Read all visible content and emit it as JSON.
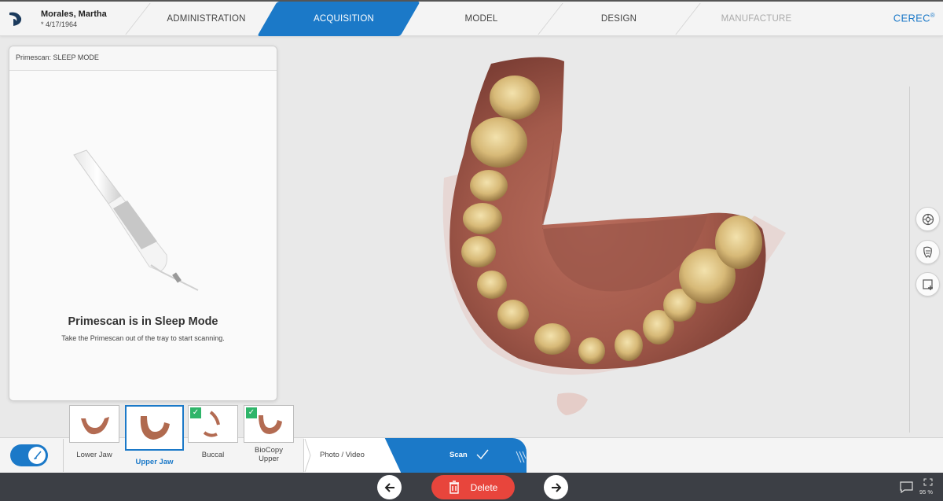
{
  "patient": {
    "name": "Morales, Martha",
    "dob": "* 4/17/1964"
  },
  "tabs": [
    {
      "label": "ADMINISTRATION",
      "state": "normal"
    },
    {
      "label": "ACQUISITION",
      "state": "active"
    },
    {
      "label": "MODEL",
      "state": "normal"
    },
    {
      "label": "DESIGN",
      "state": "normal"
    },
    {
      "label": "MANUFACTURE",
      "state": "disabled"
    }
  ],
  "brand": {
    "name": "CEREC",
    "mark": "®"
  },
  "panel": {
    "header": "Primescan: SLEEP MODE",
    "title": "Primescan is in Sleep Mode",
    "subtitle": "Take the Primescan out of the tray to start scanning."
  },
  "thumbnails": [
    {
      "label": "Lower Jaw",
      "checked": false,
      "selected": false
    },
    {
      "label": "Upper Jaw",
      "checked": false,
      "selected": true
    },
    {
      "label": "Buccal",
      "checked": true,
      "selected": false
    },
    {
      "label": "BioCopy Upper",
      "checked": true,
      "selected": false
    }
  ],
  "bottom": {
    "photo_video": "Photo / Video",
    "scan": "Scan"
  },
  "footer": {
    "delete_label": "Delete",
    "zoom": "95 %"
  },
  "colors": {
    "accent": "#1b79c8",
    "delete": "#e8453c",
    "check": "#2fb56a",
    "footer": "#3c3f45"
  },
  "icons": {
    "logo": "dentsply-logo-icon",
    "tool1": "tooth-view-icon",
    "tool2": "dental-model-icon",
    "tool3": "add-window-icon",
    "prev": "arrow-left-icon",
    "next": "arrow-right-icon",
    "delete": "trash-icon",
    "comment": "comment-icon",
    "fullscreen": "expand-icon"
  }
}
